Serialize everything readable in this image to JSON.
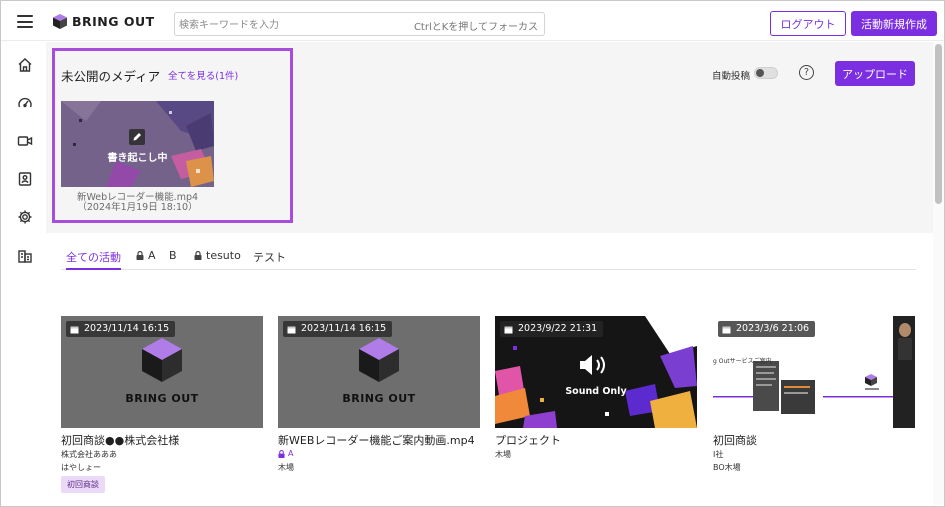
{
  "header": {
    "logo_text": "BRING OUT",
    "search_placeholder": "検索キーワードを入力",
    "search_hint": "CtrlとKを押してフォーカス",
    "logout_label": "ログアウト",
    "create_label": "活動新規作成"
  },
  "sidebar": {
    "items": [
      "home-icon",
      "dashboard-icon",
      "video-camera-icon",
      "contact-icon",
      "settings-icon",
      "organization-icon"
    ]
  },
  "unpublished": {
    "title": "未公開のメディア",
    "see_all": "全てを見る(1件)",
    "media": {
      "status_label": "書き起こし中",
      "filename": "新Webレコーダー機能.mp4",
      "datetime": "（2024年1月19日 18:10）"
    },
    "autopost_label": "自動投稿",
    "autopost_on": false,
    "upload_label": "アップロード"
  },
  "tabs": [
    {
      "label": "全ての活動",
      "locked": false,
      "active": true
    },
    {
      "label": "A",
      "locked": true,
      "active": false
    },
    {
      "label": "B",
      "locked": false,
      "active": false
    },
    {
      "label": "tesuto",
      "locked": true,
      "active": false
    },
    {
      "label": "テスト",
      "locked": false,
      "active": false
    }
  ],
  "cards": [
    {
      "date": "2023/11/14 16:15",
      "thumb_text": "BRING OUT",
      "title": "初回商談●●株式会社様",
      "meta1": "株式会社あああ",
      "meta2": "はやしょー",
      "tag": "初回商談"
    },
    {
      "date": "2023/11/14 16:15",
      "thumb_text": "BRING OUT",
      "title": "新WEBレコーダー機能ご案内動画.mp4",
      "meta_locked": "A",
      "meta2": "木場"
    },
    {
      "date": "2023/9/22 21:31",
      "thumb_text": "Sound Only",
      "title": "プロジェクト",
      "meta1": "木場"
    },
    {
      "date": "2023/3/6 21:06",
      "thumb_text": "g Outサービスご案内",
      "title": "初回商談",
      "meta1": "I社",
      "meta2": "BO木場"
    }
  ],
  "colors": {
    "accent": "#7b2fe0",
    "highlight": "#a64ddb",
    "tag_bg": "#ead9f7"
  }
}
